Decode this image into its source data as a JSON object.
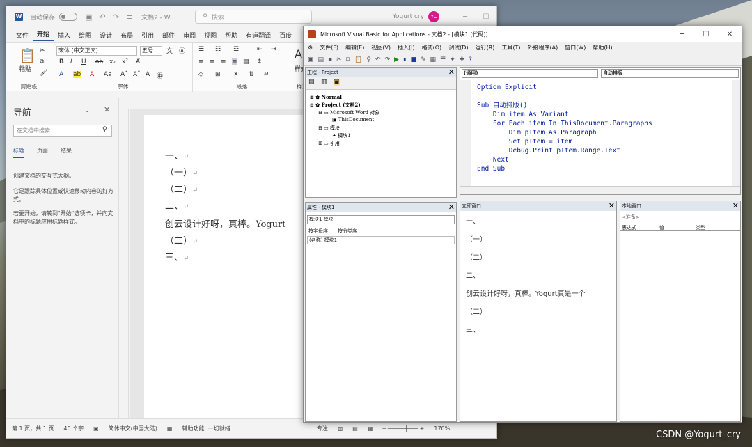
{
  "word": {
    "autosave_label": "自动保存",
    "toggle_state": "关",
    "doc_title": "文档2 - W...",
    "search_placeholder": "搜索",
    "user_name": "Yogurt cry",
    "user_initials": "YC",
    "tabs": [
      "文件",
      "开始",
      "插入",
      "绘图",
      "设计",
      "布局",
      "引用",
      "邮件",
      "审阅",
      "视图",
      "帮助",
      "有道翻译",
      "百度"
    ],
    "ribbon": {
      "paste": "粘贴",
      "clipboard": "剪贴板",
      "font_name": "宋体 (中文正文)",
      "font_size": "五号",
      "font_group": "字体",
      "para_group": "段落",
      "style_group": "样式",
      "style_btn": "样式"
    },
    "nav": {
      "title": "导航",
      "search_placeholder": "在文档中搜索",
      "tabs": [
        "标题",
        "页面",
        "结果"
      ],
      "text1": "创建文档的交互式大纲。",
      "text2": "它是跟踪具体位置或快速移动内容的好方式。",
      "text3": "若要开始，请转到\"开始\"选项卡，并向文档中的标题应用标题样式。"
    },
    "doc_lines": [
      "一、",
      "（一）",
      "（二）",
      "二、",
      "创云设计好呀，真棒。Yogurt",
      "（二）",
      "三、"
    ],
    "status": {
      "page": "第 1 页，共 1 页",
      "words": "40 个字",
      "lang": "简体中文(中国大陆)",
      "access": "辅助功能: 一切就绪",
      "focus": "专注",
      "zoom": "170%"
    }
  },
  "vba": {
    "title": "Microsoft Visual Basic for Applications - 文档2 - [模块1 (代码)]",
    "menu": [
      "文件(F)",
      "编辑(E)",
      "视图(V)",
      "插入(I)",
      "格式(O)",
      "调试(D)",
      "运行(R)",
      "工具(T)",
      "外接程序(A)",
      "窗口(W)",
      "帮助(H)"
    ],
    "project": {
      "title": "工程 - Project",
      "normal": "Normal",
      "project": "Project (文档2)",
      "word_objects": "Microsoft Word 对象",
      "this_doc": "ThisDocument",
      "modules": "模块",
      "module1": "模块1",
      "refs": "引用"
    },
    "props": {
      "title": "属性 - 模块1",
      "combo": "模块1 模块",
      "tab1": "按字母序",
      "tab2": "按分类序",
      "row": "(名称) 模块1"
    },
    "code": {
      "combo_left": "(通用)",
      "combo_right": "自动排版",
      "lines": [
        "Option Explicit",
        "",
        "Sub 自动排版()",
        "    Dim item As Variant",
        "    For Each item In ThisDocument.Paragraphs",
        "        Dim pItem As Paragraph",
        "        Set pItem = item",
        "        Debug.Print pItem.Range.Text",
        "    Next",
        "End Sub"
      ]
    },
    "immediate": {
      "title": "立即窗口",
      "lines": [
        "一、",
        "（一）",
        "（二）",
        "二、",
        "创云设计好呀，真棒。Yogurt真是一个",
        "（二）",
        "三、"
      ]
    },
    "locals": {
      "title": "本地窗口",
      "ready": "<准备>",
      "cols": [
        "表达式",
        "值",
        "类型"
      ]
    }
  },
  "watermark": "CSDN @Yogurt_cry"
}
